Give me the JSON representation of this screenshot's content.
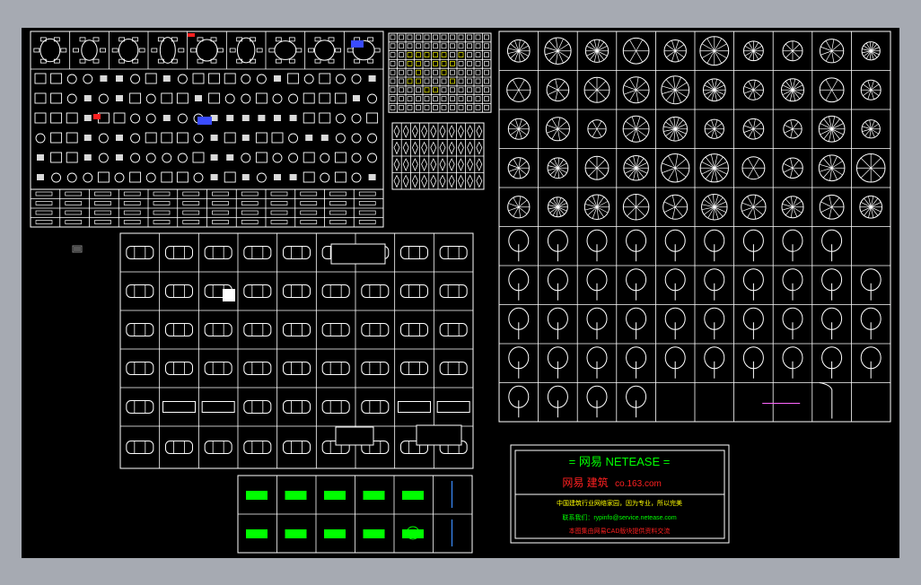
{
  "title_block": {
    "heading": "= 网易 NETEASE =",
    "subheading": "网易 建筑",
    "domain": "co.163.com",
    "line1": "中国建筑行业网络家园，因为专业，所以完美",
    "line2": "联系我们：rypinfo@service.netease.com",
    "line3": "本图集由网易CAD版块提供资料交流"
  },
  "colors": {
    "background": "#000000",
    "border": "#a6aab2",
    "lines": "#ffffff",
    "green_accent": "#00ff00",
    "red_accent": "#ff2020",
    "yellow_accent": "#ffff00",
    "blue_accent": "#3a4cff"
  },
  "panels": {
    "furniture": "furniture-blocks",
    "small_grid": "appliance-blocks",
    "fixtures": "fixture-blocks",
    "vehicles": "vehicle-blocks",
    "signs": "sign-blocks",
    "plants": "plant-blocks"
  },
  "icons": {
    "marker": "ucs-marker-icon"
  }
}
